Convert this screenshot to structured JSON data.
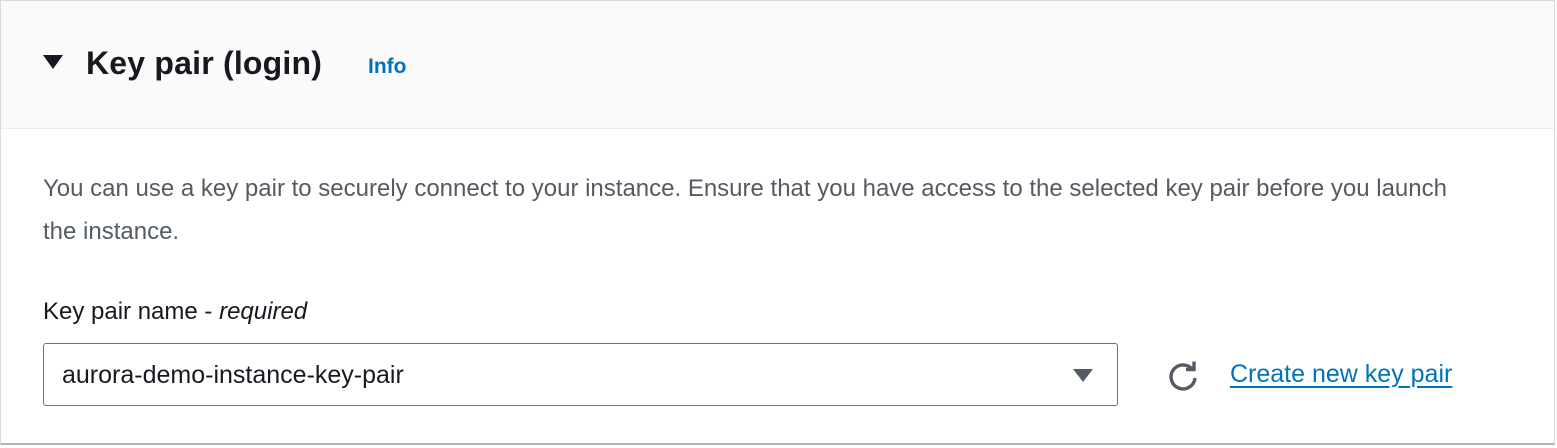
{
  "section": {
    "title": "Key pair (login)",
    "info_label": "Info",
    "expanded": true,
    "description": "You can use a key pair to securely connect to your instance. Ensure that you have access to the selected key pair before you launch the instance."
  },
  "key_pair_field": {
    "label": "Key pair name - ",
    "required_label": "required",
    "selected_value": "aurora-demo-instance-key-pair"
  },
  "actions": {
    "refresh_icon": "refresh-icon",
    "create_link": "Create new key pair"
  },
  "colors": {
    "link": "#0073bb",
    "title": "#16191f",
    "body_text": "#545b64",
    "header_bg": "#fafafa"
  }
}
